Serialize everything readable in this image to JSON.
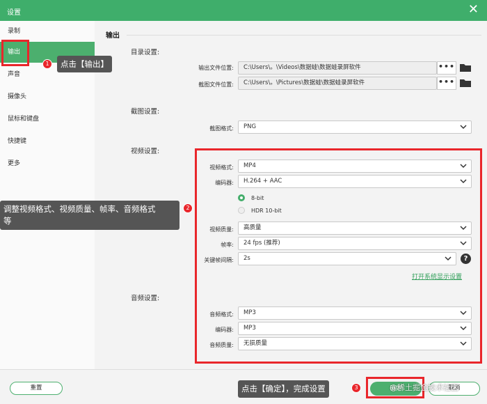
{
  "window": {
    "title": "设置",
    "close_label": "✕"
  },
  "sidebar": {
    "items": [
      {
        "label": "录制"
      },
      {
        "label": "输出"
      },
      {
        "label": "声音"
      },
      {
        "label": "摄像头"
      },
      {
        "label": "鼠标和键盘"
      },
      {
        "label": "快捷键"
      },
      {
        "label": "更多"
      }
    ]
  },
  "output": {
    "section_title": "输出",
    "directory": {
      "group_label": "目录设置:",
      "output_label": "输出文件位置:",
      "output_path": "C:\\Users\\。\\Videos\\数据蛙\\数据蛙录屏软件",
      "screenshot_label": "截图文件位置:",
      "screenshot_path": "C:\\Users\\。\\Pictures\\数据蛙\\数据蛙录屏软件",
      "browse_label": "•••"
    },
    "screenshot": {
      "group_label": "截图设置:",
      "format_label": "截图格式:",
      "format_value": "PNG"
    },
    "video": {
      "group_label": "视频设置:",
      "format_label": "视频格式:",
      "format_value": "MP4",
      "encoder_label": "编码器:",
      "encoder_value": "H.264 + AAC",
      "bit_options": [
        {
          "label": "8-bit",
          "selected": true
        },
        {
          "label": "HDR 10-bit",
          "selected": false
        }
      ],
      "quality_label": "视频质量:",
      "quality_value": "高质量",
      "framerate_label": "帧率:",
      "framerate_value": "24 fps (推荐)",
      "keyframe_label": "关键帧间隔:",
      "keyframe_value": "2s",
      "help_label": "?",
      "system_link": "打开系统显示设置"
    },
    "audio": {
      "group_label": "音频设置:",
      "format_label": "音频格式:",
      "format_value": "MP3",
      "encoder_label": "编码器:",
      "encoder_value": "MP3",
      "quality_label": "音频质量:",
      "quality_value": "无损质量"
    }
  },
  "footer": {
    "reset_label": "重置",
    "ok_label": "确定",
    "cancel_label": "取消"
  },
  "annotations": {
    "step1": {
      "number": "1",
      "text": "点击【输出】"
    },
    "step2": {
      "number": "2",
      "text_line1": "调整视频格式、视频质量、帧率、音频格式",
      "text_line2": "等"
    },
    "step3": {
      "number": "3",
      "text": "点击【确定】，完成设置"
    }
  },
  "watermark": "@稀土掘金技术社区",
  "colors": {
    "brand_green": "#4caf6e",
    "title_green": "#3fae6b",
    "annotation_red": "#e9262b",
    "callout_gray": "#555555"
  }
}
